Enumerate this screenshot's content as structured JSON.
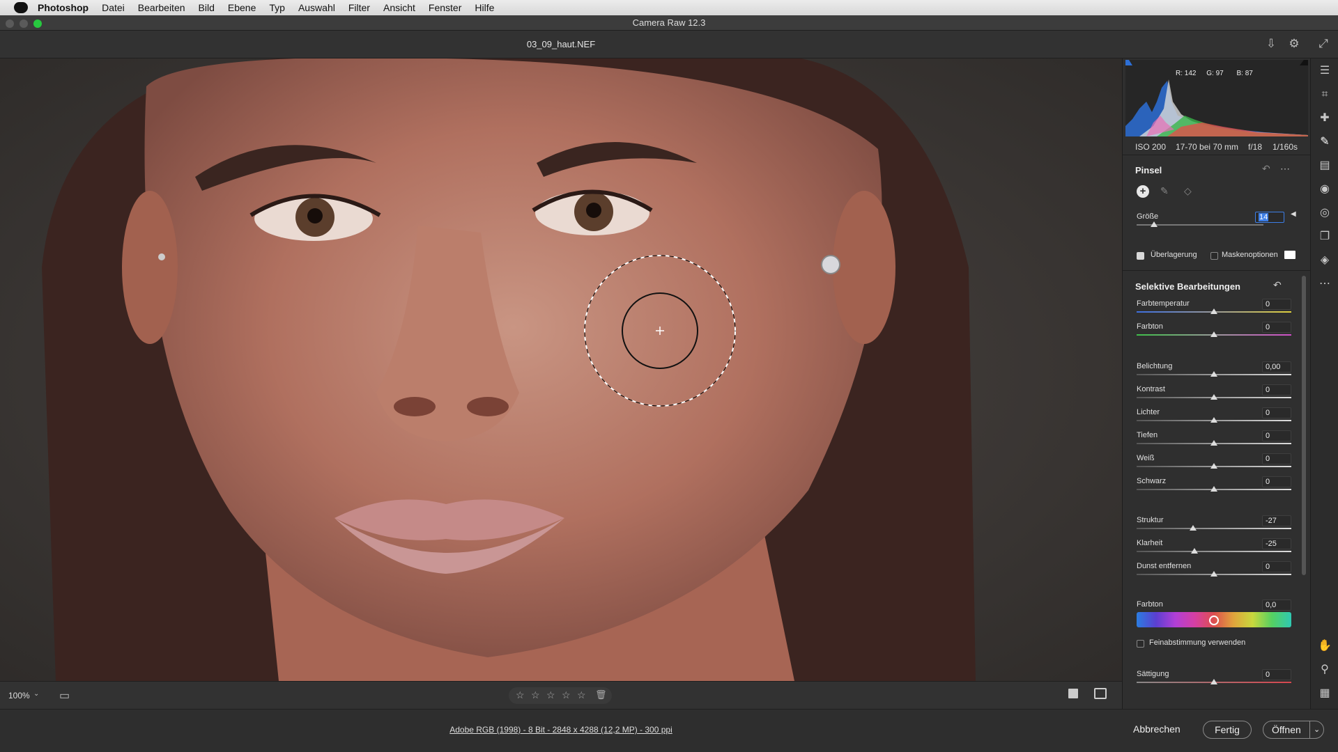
{
  "menubar": {
    "app": "Photoshop",
    "items": [
      "Datei",
      "Bearbeiten",
      "Bild",
      "Ebene",
      "Typ",
      "Auswahl",
      "Filter",
      "Ansicht",
      "Fenster",
      "Hilfe"
    ]
  },
  "window": {
    "title": "Camera Raw 12.3"
  },
  "document": {
    "filename": "03_09_haut.NEF"
  },
  "histogram": {
    "r_label": "R:",
    "r_value": "142",
    "g_label": "G:",
    "g_value": "97",
    "b_label": "B:",
    "b_value": "87"
  },
  "camera": {
    "iso": "ISO 200",
    "lens": "17-70 bei 70 mm",
    "aperture": "f/18",
    "shutter": "1/160s"
  },
  "brush": {
    "title": "Pinsel",
    "size_label": "Größe",
    "size_value": "14",
    "size_level_fraction": 0.14,
    "overlay_label": "Überlagerung",
    "overlay_checked": true,
    "mask_label": "Maskenoptionen",
    "mask_checked": false
  },
  "selective": {
    "title": "Selektive Bearbeitungen",
    "group1": [
      {
        "label": "Farbtemperatur",
        "value": "0",
        "level": 0.5,
        "track": "temp"
      },
      {
        "label": "Farbton",
        "value": "0",
        "level": 0.5,
        "track": "tint"
      }
    ],
    "group2": [
      {
        "label": "Belichtung",
        "value": "0,00",
        "level": 0.5
      },
      {
        "label": "Kontrast",
        "value": "0",
        "level": 0.5
      },
      {
        "label": "Lichter",
        "value": "0",
        "level": 0.5
      },
      {
        "label": "Tiefen",
        "value": "0",
        "level": 0.5
      },
      {
        "label": "Weiß",
        "value": "0",
        "level": 0.5
      },
      {
        "label": "Schwarz",
        "value": "0",
        "level": 0.5
      }
    ],
    "group3": [
      {
        "label": "Struktur",
        "value": "-27",
        "level": 0.365
      },
      {
        "label": "Klarheit",
        "value": "-25",
        "level": 0.375
      },
      {
        "label": "Dunst entfernen",
        "value": "0",
        "level": 0.5
      }
    ],
    "hue_label": "Farbton",
    "hue_value": "0,0",
    "hue_level": 0.5,
    "finetune_label": "Feinabstimmung verwenden",
    "finetune_checked": false,
    "saturation_label": "Sättigung",
    "saturation_value": "0",
    "saturation_level": 0.5
  },
  "view": {
    "zoom": "100%"
  },
  "status": {
    "info": "Adobe RGB (1998) - 8 Bit - 2848 x 4288 (12,2 MP) - 300 ppi"
  },
  "buttons": {
    "cancel": "Abbrechen",
    "done": "Fertig",
    "open": "Öffnen"
  },
  "colors": {
    "accent": "#3d7ee6",
    "panel": "#2f2f2f",
    "menubar": "#e2e2e2"
  }
}
